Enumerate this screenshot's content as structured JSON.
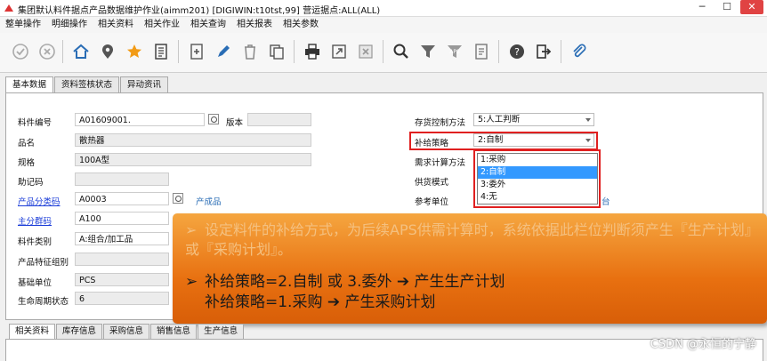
{
  "window": {
    "title": "集团默认料件据点产品数据维护作业(aimm201)    [DIGIWIN:t10tst,99]    营运据点:ALL(ALL)"
  },
  "menu": [
    "整单操作",
    "明细操作",
    "相关资料",
    "相关作业",
    "相关查询",
    "相关报表",
    "相关参数"
  ],
  "toolbar_icons": [
    "confirm-icon",
    "cancel-icon",
    "home-icon",
    "location-icon",
    "star-icon",
    "list-icon",
    "add-icon",
    "edit-icon",
    "delete-icon",
    "copy-icon",
    "print-icon",
    "export-icon",
    "excel-icon",
    "search-icon",
    "filter-icon",
    "aps-icon",
    "query-icon",
    "help-icon",
    "exit-icon",
    "attach-icon"
  ],
  "top_tabs": [
    "基本数据",
    "资料签核状态",
    "异动资讯"
  ],
  "form": {
    "item_no": {
      "label": "料件编号",
      "value": "A01609001."
    },
    "version": {
      "label": "版本",
      "value": ""
    },
    "name": {
      "label": "品名",
      "value": "散热器"
    },
    "spec": {
      "label": "规格",
      "value": "100A型"
    },
    "mnemonic": {
      "label": "助记码",
      "value": ""
    },
    "category": {
      "label": "产品分类码",
      "value": "A0003",
      "desc": "产成品"
    },
    "main_group": {
      "label": "主分群码",
      "value": "A100"
    },
    "item_type": {
      "label": "料件类别",
      "value": "A:组合/加工品"
    },
    "feature_group": {
      "label": "产品特征组别",
      "value": ""
    },
    "base_unit": {
      "label": "基础单位",
      "value": "PCS"
    },
    "lifecycle": {
      "label": "生命周期状态",
      "value": "6"
    },
    "inventory_method": {
      "label": "存货控制方法",
      "value": "5:人工判断"
    },
    "supply_policy": {
      "label": "补给策略",
      "value": "2:自制"
    },
    "demand_calc": {
      "label": "需求计算方法",
      "value": ""
    },
    "supply_mode": {
      "label": "供货模式",
      "value": ""
    },
    "ref_unit": {
      "label": "参考单位",
      "value": ""
    },
    "ref_unit_tail": "台"
  },
  "dropdown_options": [
    {
      "label": "1:采购",
      "selected": false
    },
    {
      "label": "2:自制",
      "selected": true
    },
    {
      "label": "3:委外",
      "selected": false
    },
    {
      "label": "4:无",
      "selected": false
    }
  ],
  "callout": {
    "line1": "设定料件的补给方式，为后续APS供需计算时，系统依据此栏位判断须产生『生产计划』或『采购计划』。",
    "line2": "补给策略=2.自制 或 3.委外 ➔ 产生生产计划",
    "line3": "补给策略=1.采购 ➔ 产生采购计划",
    "bullet": "➢"
  },
  "bottom_tabs": [
    "相关资料",
    "库存信息",
    "采购信息",
    "销售信息",
    "生产信息"
  ],
  "watermark": "CSDN @永恒的宁静",
  "colors": {
    "callout": "#e87010",
    "highlight": "#e02020",
    "link": "#1a3cd8",
    "selected": "#3399ff"
  }
}
